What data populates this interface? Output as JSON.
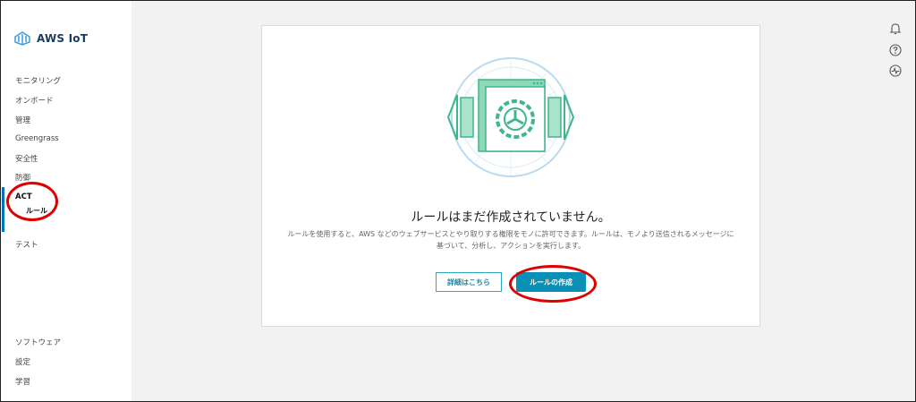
{
  "app": {
    "title": "AWS IoT"
  },
  "sidebar": {
    "items": [
      {
        "label": "モニタリング"
      },
      {
        "label": "オンボード"
      },
      {
        "label": "管理"
      },
      {
        "label": "Greengrass"
      },
      {
        "label": "安全性"
      },
      {
        "label": "防御"
      },
      {
        "label": "ACT"
      },
      {
        "label": "ルール"
      },
      {
        "label": "テスト"
      }
    ],
    "bottom_items": [
      {
        "label": "ソフトウェア"
      },
      {
        "label": "設定"
      },
      {
        "label": "学習"
      }
    ]
  },
  "empty_state": {
    "title": "ルールはまだ作成されていません。",
    "description": "ルールを使用すると、AWS などのウェブサービスとやり取りする権限をモノに許可できます。ルールは、モノより送信されるメッセージに基づいて、分析し、アクションを実行します。",
    "learn_more_label": "詳細はこちら",
    "create_label": "ルールの作成"
  },
  "header_icons": [
    "bell-icon",
    "help-icon",
    "activity-icon"
  ],
  "colors": {
    "accent": "#0a8fb7",
    "illustration": "#3fb68b",
    "annotation": "#dd0000"
  }
}
